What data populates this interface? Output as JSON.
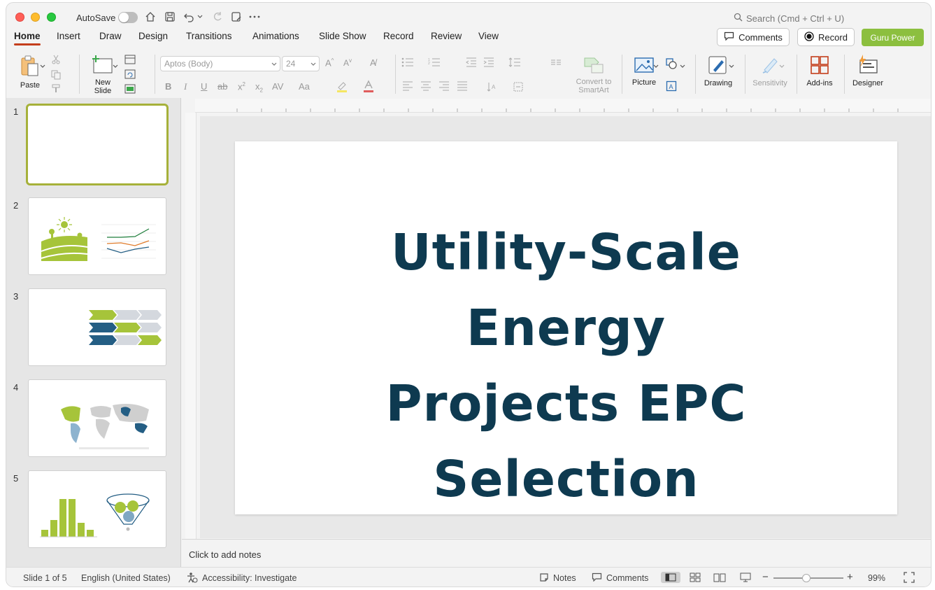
{
  "titlebar": {
    "autosave_label": "AutoSave",
    "search_placeholder": "Search (Cmd + Ctrl + U)"
  },
  "tabs": [
    "Home",
    "Insert",
    "Draw",
    "Design",
    "Transitions",
    "Animations",
    "Slide Show",
    "Record",
    "Review",
    "View"
  ],
  "header_buttons": {
    "comments": "Comments",
    "record": "Record",
    "guru": "Guru Power"
  },
  "ribbon": {
    "paste": "Paste",
    "new_slide": "New Slide",
    "font_name": "Aptos (Body)",
    "font_size": "24",
    "convert_smartart": "Convert to SmartArt",
    "picture": "Picture",
    "drawing": "Drawing",
    "sensitivity": "Sensitivity",
    "addins": "Add-ins",
    "designer": "Designer"
  },
  "thumbnails": [
    {
      "num": "1"
    },
    {
      "num": "2"
    },
    {
      "num": "3"
    },
    {
      "num": "4"
    },
    {
      "num": "5"
    }
  ],
  "slide": {
    "title_line1": "Utility-Scale Energy",
    "title_line2": "Projects EPC",
    "title_line3": "Selection"
  },
  "notes_placeholder": "Click to add notes",
  "status": {
    "slide_of": "Slide 1 of 5",
    "language": "English (United States)",
    "accessibility": "Accessibility: Investigate",
    "notes": "Notes",
    "comments": "Comments",
    "zoom": "99%"
  },
  "colors": {
    "accent_green": "#8cbf3f",
    "title_navy": "#0e3a50",
    "tab_underline": "#c43e1c"
  }
}
